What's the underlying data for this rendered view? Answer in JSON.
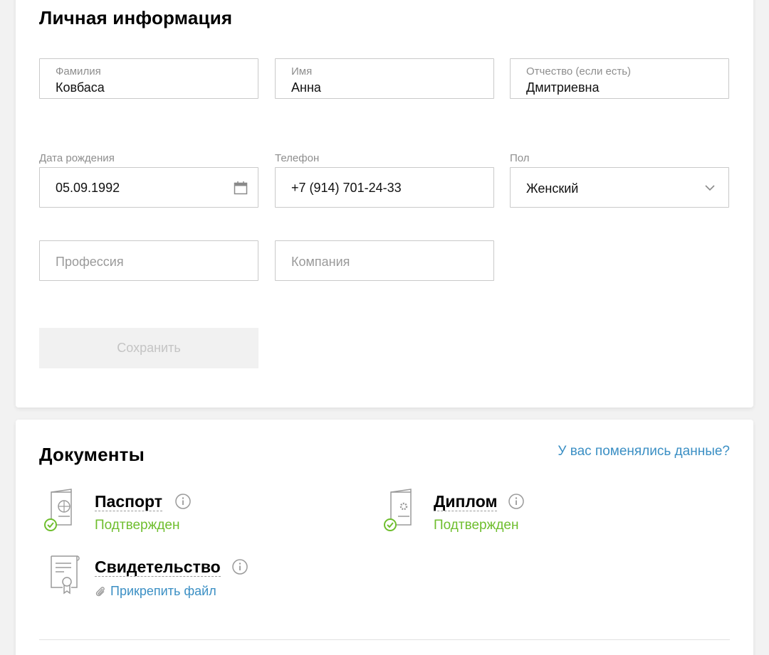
{
  "personal": {
    "title": "Личная информация",
    "surname": {
      "label": "Фамилия",
      "value": "Ковбаса"
    },
    "name": {
      "label": "Имя",
      "value": "Анна"
    },
    "patronymic": {
      "label": "Отчество (если есть)",
      "value": "Дмитриевна"
    },
    "birthdate": {
      "label": "Дата рождения",
      "value": "05.09.1992"
    },
    "phone": {
      "label": "Телефон",
      "value": "+7 (914) 701-24-33"
    },
    "gender": {
      "label": "Пол",
      "value": "Женский"
    },
    "profession": {
      "placeholder": "Профессия"
    },
    "company": {
      "placeholder": "Компания"
    },
    "save_label": "Сохранить"
  },
  "documents": {
    "title": "Документы",
    "change_link": "У вас поменялись данные?",
    "items": [
      {
        "title": "Паспорт",
        "status": "Подтвержден",
        "icon": "passport-icon"
      },
      {
        "title": "Диплом",
        "status": "Подтвержден",
        "icon": "diploma-icon"
      },
      {
        "title": "Свидетельство",
        "action": "Прикрепить файл",
        "icon": "certificate-icon"
      }
    ]
  },
  "colors": {
    "accent_link": "#3b8fc4",
    "status_ok": "#6fbe2e",
    "border": "#c9c9c9"
  }
}
